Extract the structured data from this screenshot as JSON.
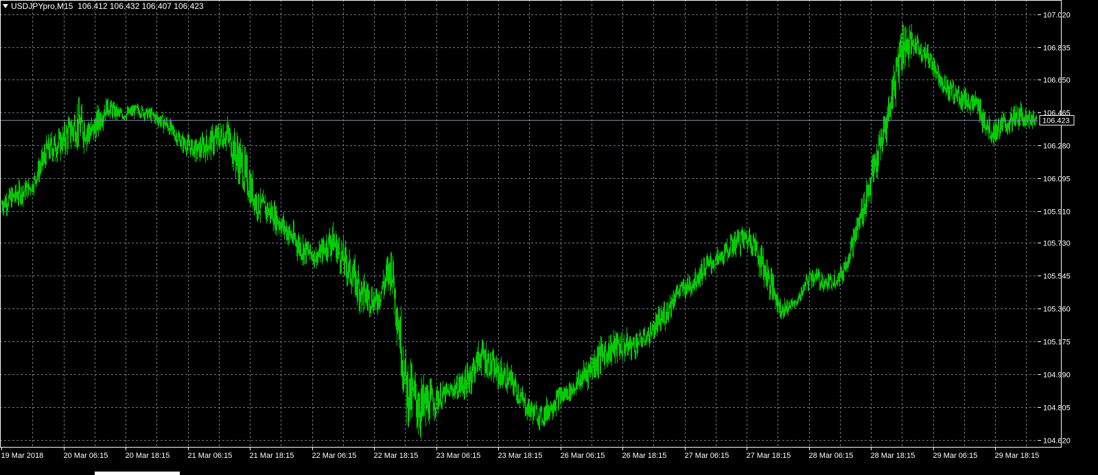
{
  "header": {
    "symbol": "USDJPYpro,M15",
    "ohlc": "106.412 106.432 106.407 106.423"
  },
  "colors": {
    "background": "#000000",
    "candles": "#00cc00",
    "grid": "#6b7a8c",
    "axis": "#ffffff",
    "bid_line": "#7a8ba0"
  },
  "chart_data": {
    "type": "line",
    "title": "USDJPYpro,M15",
    "ylim": [
      104.58,
      107.1
    ],
    "y_ticks": [
      107.02,
      106.835,
      106.65,
      106.465,
      106.28,
      106.095,
      105.91,
      105.73,
      105.545,
      105.36,
      105.175,
      104.99,
      104.805,
      104.62
    ],
    "y_tick_labels": [
      "107.020",
      "106.835",
      "106.650",
      "106.465",
      "106.280",
      "106.095",
      "105.910",
      "105.730",
      "105.545",
      "105.360",
      "105.175",
      "104.990",
      "104.805",
      "104.620"
    ],
    "x_tick_labels": [
      "19 Mar 2018",
      "20 Mar 06:15",
      "20 Mar 18:15",
      "21 Mar 06:15",
      "21 Mar 18:15",
      "22 Mar 06:15",
      "22 Mar 18:15",
      "23 Mar 06:15",
      "23 Mar 18:15",
      "26 Mar 06:15",
      "26 Mar 18:15",
      "27 Mar 06:15",
      "27 Mar 18:15",
      "28 Mar 06:15",
      "28 Mar 18:15",
      "29 Mar 06:15",
      "29 Mar 18:15"
    ],
    "grid": true,
    "current_price": 106.423,
    "current_price_label": "106.423",
    "series": [
      {
        "x": [
          "19 Mar 2018",
          "19 Mar 09:00",
          "19 Mar 16:00",
          "19 Mar 21:00",
          "20 Mar 02:00",
          "20 Mar 06:15",
          "20 Mar 09:00",
          "20 Mar 12:00",
          "20 Mar 15:00",
          "20 Mar 18:15",
          "20 Mar 22:00",
          "21 Mar 03:00",
          "21 Mar 06:15",
          "21 Mar 10:00",
          "21 Mar 13:00",
          "21 Mar 16:30",
          "21 Mar 18:15",
          "21 Mar 19:30",
          "21 Mar 22:00",
          "22 Mar 00:30",
          "22 Mar 03:00",
          "22 Mar 06:15",
          "22 Mar 09:00",
          "22 Mar 12:00",
          "22 Mar 15:00",
          "22 Mar 16:30",
          "22 Mar 18:15",
          "22 Mar 19:30",
          "22 Mar 20:00",
          "22 Mar 22:00",
          "23 Mar 01:00",
          "23 Mar 04:00",
          "23 Mar 06:15",
          "23 Mar 08:00",
          "23 Mar 11:00",
          "23 Mar 14:00",
          "23 Mar 16:30",
          "23 Mar 18:15",
          "26 Mar 00:00",
          "26 Mar 03:00",
          "26 Mar 06:15",
          "26 Mar 09:00",
          "26 Mar 12:00",
          "26 Mar 15:00",
          "26 Mar 18:15",
          "26 Mar 21:00",
          "27 Mar 01:00",
          "27 Mar 04:00",
          "27 Mar 06:15",
          "27 Mar 09:00",
          "27 Mar 12:00",
          "27 Mar 15:00",
          "27 Mar 18:15",
          "27 Mar 21:00",
          "28 Mar 00:00",
          "28 Mar 03:00",
          "28 Mar 06:15",
          "28 Mar 09:00",
          "28 Mar 12:00",
          "28 Mar 15:00",
          "28 Mar 18:15",
          "28 Mar 21:00",
          "29 Mar 00:00",
          "29 Mar 03:00",
          "29 Mar 06:15",
          "29 Mar 09:00",
          "29 Mar 12:00",
          "29 Mar 15:00",
          "29 Mar 18:15",
          "29 Mar 20:00"
        ],
        "high": [
          106.05,
          106.18,
          106.1,
          106.35,
          106.38,
          106.65,
          106.5,
          106.55,
          106.5,
          106.55,
          106.55,
          106.5,
          106.4,
          106.35,
          106.4,
          106.45,
          106.66,
          106.2,
          106.1,
          106.0,
          105.95,
          105.75,
          105.95,
          105.85,
          105.75,
          105.55,
          105.82,
          105.4,
          105.3,
          105.0,
          104.95,
          105.05,
          105.2,
          105.25,
          105.1,
          104.95,
          104.9,
          104.9,
          105.0,
          105.2,
          105.25,
          105.3,
          105.3,
          105.25,
          105.45,
          105.5,
          105.6,
          105.7,
          105.75,
          105.8,
          105.9,
          105.8,
          105.5,
          105.4,
          105.65,
          105.6,
          105.65,
          105.9,
          106.3,
          106.5,
          106.97,
          107.0,
          106.9,
          106.8,
          106.68,
          106.65,
          106.5,
          106.55,
          106.55,
          106.5
        ],
        "low": [
          105.8,
          105.9,
          105.9,
          106.0,
          106.05,
          106.15,
          106.1,
          106.3,
          106.35,
          106.4,
          106.4,
          106.3,
          106.2,
          106.1,
          106.05,
          106.1,
          106.05,
          105.85,
          105.8,
          105.7,
          105.6,
          105.55,
          105.55,
          105.45,
          105.3,
          105.25,
          105.3,
          104.7,
          104.62,
          104.7,
          104.75,
          104.65,
          104.85,
          104.9,
          104.8,
          104.7,
          104.65,
          104.62,
          104.8,
          104.85,
          104.9,
          104.95,
          105.0,
          105.05,
          105.1,
          105.3,
          105.35,
          105.45,
          105.55,
          105.5,
          105.6,
          105.4,
          105.3,
          105.3,
          105.4,
          105.42,
          105.45,
          105.6,
          105.85,
          106.05,
          106.4,
          106.75,
          106.65,
          106.55,
          106.4,
          106.35,
          106.25,
          106.25,
          106.3,
          106.35
        ],
        "close": [
          105.95,
          106.0,
          106.05,
          106.25,
          106.3,
          106.4,
          106.35,
          106.5,
          106.45,
          106.48,
          106.45,
          106.4,
          106.3,
          106.25,
          106.3,
          106.35,
          106.15,
          105.95,
          105.9,
          105.8,
          105.7,
          105.65,
          105.75,
          105.6,
          105.45,
          105.4,
          105.6,
          104.9,
          104.8,
          104.85,
          104.9,
          104.95,
          105.1,
          105.0,
          104.95,
          104.8,
          104.75,
          104.85,
          104.9,
          105.0,
          105.1,
          105.15,
          105.15,
          105.2,
          105.3,
          105.45,
          105.5,
          105.6,
          105.65,
          105.75,
          105.75,
          105.55,
          105.35,
          105.4,
          105.55,
          105.5,
          105.55,
          105.8,
          106.1,
          106.4,
          106.85,
          106.85,
          106.75,
          106.6,
          106.55,
          106.5,
          106.35,
          106.4,
          106.45,
          106.42
        ]
      }
    ]
  }
}
